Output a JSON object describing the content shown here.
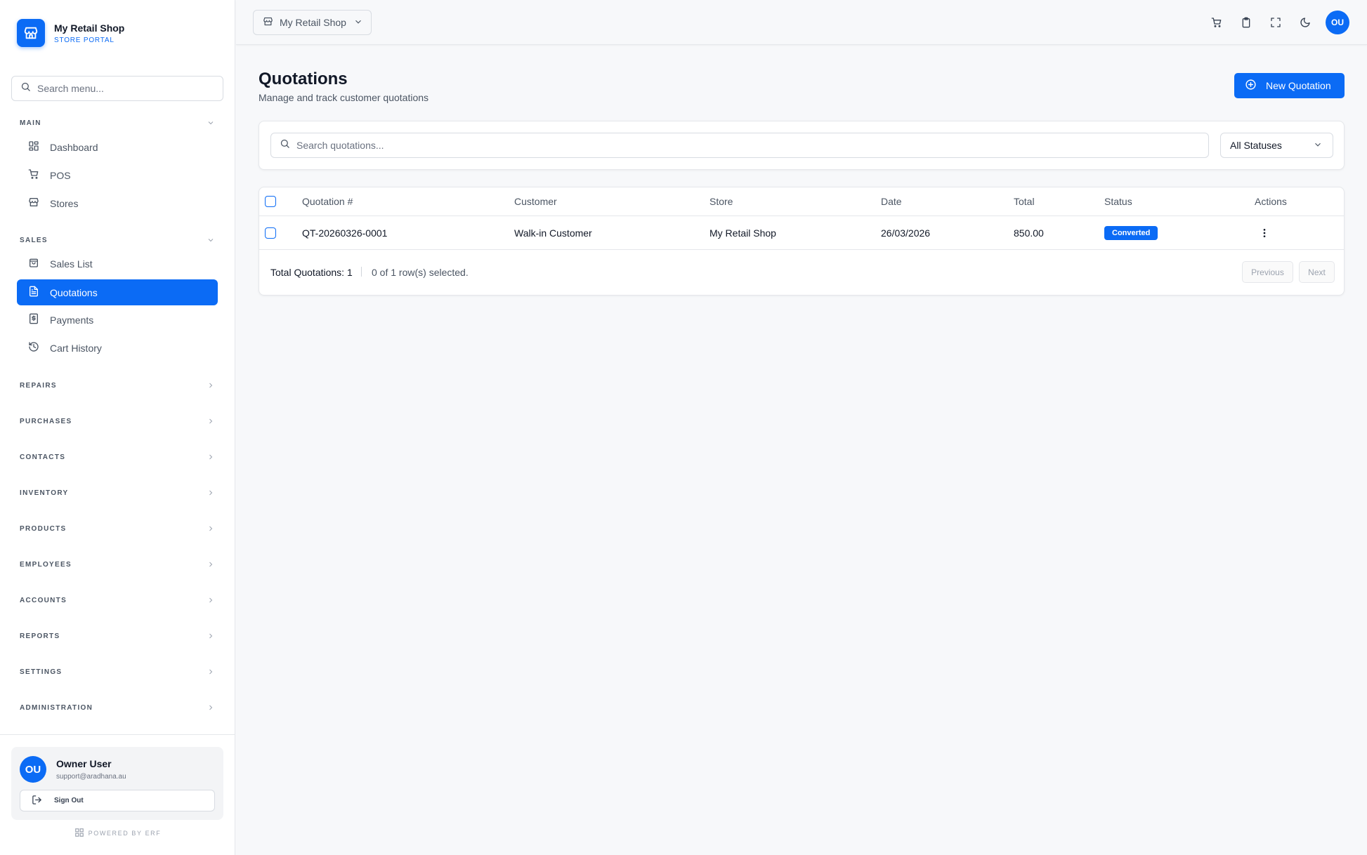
{
  "brand": {
    "name": "My Retail Shop",
    "subtitle": "STORE PORTAL",
    "icon": "store-icon"
  },
  "sidebar": {
    "search_placeholder": "Search menu...",
    "sections": {
      "main": {
        "label": "MAIN",
        "expanded": true,
        "items": [
          {
            "label": "Dashboard",
            "icon": "dashboard-icon"
          },
          {
            "label": "POS",
            "icon": "cart-icon"
          },
          {
            "label": "Stores",
            "icon": "store-icon"
          }
        ]
      },
      "sales": {
        "label": "SALES",
        "expanded": true,
        "items": [
          {
            "label": "Sales List",
            "icon": "shopping-bag-icon"
          },
          {
            "label": "Quotations",
            "icon": "file-text-icon",
            "active": true
          },
          {
            "label": "Payments",
            "icon": "dollar-receipt-icon"
          },
          {
            "label": "Cart History",
            "icon": "history-icon"
          }
        ]
      },
      "collapsed": [
        "REPAIRS",
        "PURCHASES",
        "CONTACTS",
        "INVENTORY",
        "PRODUCTS",
        "EMPLOYEES",
        "ACCOUNTS",
        "REPORTS",
        "SETTINGS",
        "ADMINISTRATION"
      ]
    },
    "user": {
      "initials": "OU",
      "name": "Owner User",
      "email": "support@aradhana.au"
    },
    "sign_out_label": "Sign Out",
    "powered_by": "POWERED BY ERF"
  },
  "topbar": {
    "store_selector": "My Retail Shop",
    "icons": [
      "cart-icon",
      "clipboard-icon",
      "fullscreen-icon",
      "moon-icon"
    ],
    "avatar_initials": "OU"
  },
  "page": {
    "title": "Quotations",
    "subtitle": "Manage and track customer quotations",
    "new_button": "New Quotation"
  },
  "filters": {
    "search_placeholder": "Search quotations...",
    "status_selected": "All Statuses"
  },
  "table": {
    "columns": [
      "Quotation #",
      "Customer",
      "Store",
      "Date",
      "Total",
      "Status",
      "Actions"
    ],
    "rows": [
      {
        "number": "QT-20260326-0001",
        "customer": "Walk-in Customer",
        "store": "My Retail Shop",
        "date": "26/03/2026",
        "total": "850.00",
        "status": "Converted"
      }
    ],
    "footer": {
      "total_text": "Total Quotations: 1",
      "selected_text": "0 of 1 row(s) selected.",
      "previous_label": "Previous",
      "next_label": "Next"
    }
  },
  "colors": {
    "accent": "#0b6bf5",
    "background": "#f7f8fa",
    "border": "#e5e7eb"
  }
}
